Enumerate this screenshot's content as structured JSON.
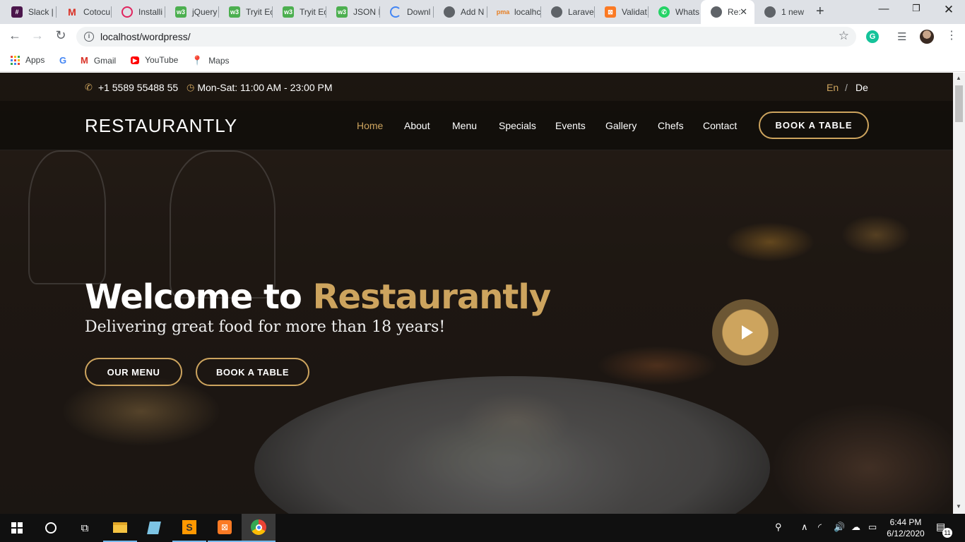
{
  "browser": {
    "tabs": [
      {
        "label": "Slack |",
        "icon": "slack-icon"
      },
      {
        "label": "Cotocu",
        "icon": "gmail-icon"
      },
      {
        "label": "Installi",
        "icon": "opencart-icon"
      },
      {
        "label": "jQuery",
        "icon": "w3schools-icon"
      },
      {
        "label": "Tryit Ec",
        "icon": "w3schools-icon"
      },
      {
        "label": "Tryit Ec",
        "icon": "w3schools-icon"
      },
      {
        "label": "JSON I",
        "icon": "w3schools-icon"
      },
      {
        "label": "Downl",
        "icon": "loading-icon"
      },
      {
        "label": "Add N",
        "icon": "globe-icon"
      },
      {
        "label": "localhc",
        "icon": "phpmyadmin-icon"
      },
      {
        "label": "Larave",
        "icon": "globe-icon"
      },
      {
        "label": "Validat",
        "icon": "xampp-icon"
      },
      {
        "label": "Whats",
        "icon": "whatsapp-icon"
      },
      {
        "label": "Re:",
        "icon": "globe-icon"
      },
      {
        "label": "1 new",
        "icon": "globe-icon"
      }
    ],
    "address": "localhost/wordpress/",
    "bookmarks": [
      {
        "label": "Apps"
      },
      {
        "label": ""
      },
      {
        "label": "Gmail"
      },
      {
        "label": "YouTube"
      },
      {
        "label": "Maps"
      }
    ],
    "extension_letter": "G"
  },
  "site": {
    "phone": "+1 5589 55488 55",
    "hours": "Mon-Sat: 11:00 AM - 23:00 PM",
    "lang_en": "En",
    "lang_sep": "/",
    "lang_de": "De",
    "logo": "RESTAURANTLY",
    "nav": [
      "Home",
      "About",
      "Menu",
      "Specials",
      "Events",
      "Gallery",
      "Chefs",
      "Contact"
    ],
    "active_nav": "Home",
    "book_table": "BOOK A TABLE",
    "hero_title_1": "Welcome to ",
    "hero_title_2": "Restaurantly",
    "hero_subtitle": "Delivering great food for more than 18 years!",
    "btn_menu": "OUR MENU",
    "btn_book": "BOOK A TABLE",
    "accent_color": "#cda45e"
  },
  "taskbar": {
    "time": "6:44 PM",
    "date": "6/12/2020",
    "notifications": "11"
  }
}
